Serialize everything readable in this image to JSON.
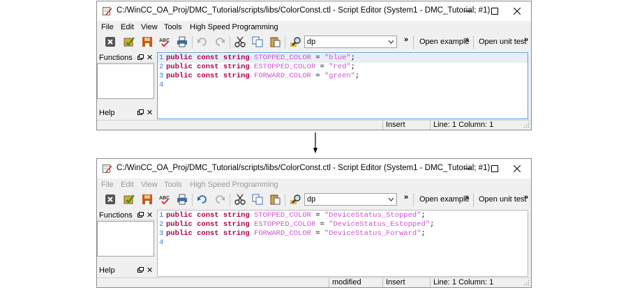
{
  "window_before": {
    "title": "C:/WinCC_OA_Proj/DMC_Tutorial/scripts/libs/ColorConst.ctl - Script Editor (System1 - DMC_Tutorial; #1)",
    "menus": [
      "File",
      "Edit",
      "View",
      "Tools",
      "High Speed Programming"
    ],
    "menus_enabled": true,
    "search_value": "dp",
    "toolbar_chevron": "»",
    "open_example": "Open example",
    "open_unit_test": "Open unit test",
    "panels": {
      "functions": "Functions",
      "help": "Help",
      "close_glyph": "✕"
    },
    "gutter": [
      "1",
      "2",
      "3",
      "4"
    ],
    "code": [
      {
        "kw": "public const string",
        "name": "STOPPED_COLOR",
        "op": " = ",
        "value": "\"blue\"",
        "end": ";"
      },
      {
        "kw": "public const string",
        "name": "ESTOPPED_COLOR",
        "op": " = ",
        "value": "\"red\"",
        "end": ";"
      },
      {
        "kw": "public const string",
        "name": "FORWARD_COLOR",
        "op": " = ",
        "value": "\"green\"",
        "end": ";"
      }
    ],
    "status": {
      "modified": "",
      "mode": "Insert",
      "position": "Line: 1 Column: 1"
    }
  },
  "window_after": {
    "title": "C:/WinCC_OA_Proj/DMC_Tutorial/scripts/libs/ColorConst.ctl - Script Editor (System1 - DMC_Tutorial; #1)",
    "menus": [
      "File",
      "Edit",
      "View",
      "Tools",
      "High Speed Programming"
    ],
    "menus_enabled": false,
    "search_value": "dp",
    "toolbar_chevron": "»",
    "open_example": "Open example",
    "open_unit_test": "Open unit test",
    "panels": {
      "functions": "Functions",
      "help": "Help",
      "close_glyph": "✕"
    },
    "gutter": [
      "1",
      "2",
      "3",
      "4"
    ],
    "code": [
      {
        "kw": "public const string",
        "name": "STOPPED_COLOR",
        "op": " = ",
        "value": "\"DeviceStatus_Stopped\"",
        "end": ";"
      },
      {
        "kw": "public const string",
        "name": "ESTOPPED_COLOR",
        "op": " = ",
        "value": "\"DeviceStatus_Estopped\"",
        "end": ";"
      },
      {
        "kw": "public const string",
        "name": "FORWARD_COLOR",
        "op": " = ",
        "value": "\"DeviceStatus_Forward\"",
        "end": ";"
      }
    ],
    "status": {
      "modified": "modified",
      "mode": "Insert",
      "position": "Line: 1 Column: 1"
    }
  },
  "colors": {
    "keyword": "#b0004a",
    "constant": "#d050d0",
    "string": "#d050d0",
    "line_number": "#2f7be0",
    "editor_border": "#5aa0e8"
  }
}
